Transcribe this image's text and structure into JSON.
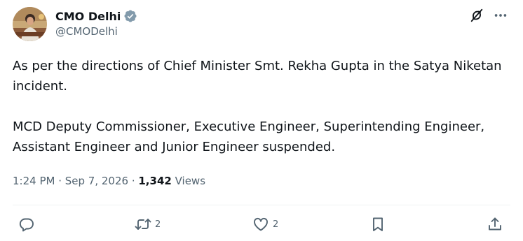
{
  "author": {
    "display_name": "CMO Delhi",
    "handle": "@CMODelhi",
    "verified_badge_icon": "verified-badge-icon",
    "badge_color": "#829aab"
  },
  "header_icons": [
    "grok-icon",
    "more-icon"
  ],
  "tweet": {
    "paragraphs": [
      "As per the directions of Chief Minister Smt. Rekha Gupta in the Satya Niketan incident.",
      "MCD Deputy Commissioner, Executive Engineer, Superintending Engineer, Assistant Engineer and Junior Engineer suspended."
    ]
  },
  "meta": {
    "time": "1:24 PM",
    "separator": " · ",
    "date": "Sep 7, 2026",
    "views_count": "1,342",
    "views_label": " Views"
  },
  "actions": {
    "reply": {
      "icon": "reply-icon",
      "count": ""
    },
    "repost": {
      "icon": "repost-icon",
      "count": "2"
    },
    "like": {
      "icon": "heart-icon",
      "count": "2"
    },
    "bookmark": {
      "icon": "bookmark-icon",
      "count": ""
    },
    "share": {
      "icon": "share-icon",
      "count": ""
    }
  },
  "colors": {
    "text_primary": "#0f1419",
    "text_secondary": "#536471",
    "divider": "#eff3f4"
  }
}
